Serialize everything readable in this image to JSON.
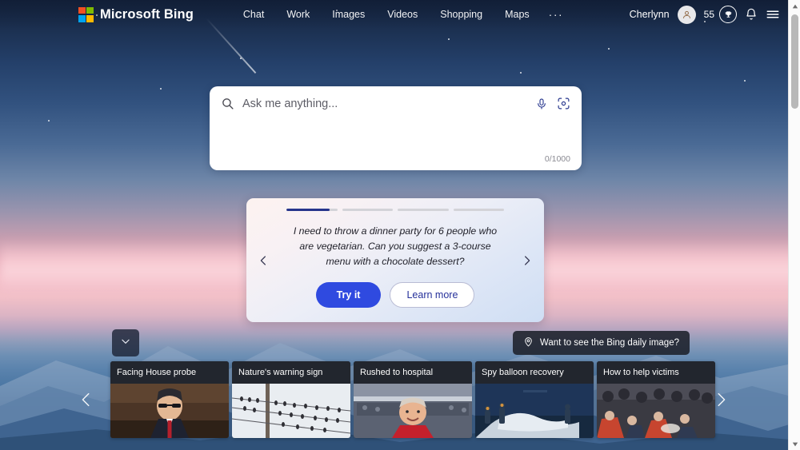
{
  "header": {
    "brand": "Microsoft Bing",
    "logo_colors": [
      "#f25022",
      "#7fba00",
      "#00a4ef",
      "#ffb900"
    ],
    "nav": [
      {
        "label": "Chat",
        "name": "nav-item-chat"
      },
      {
        "label": "Work",
        "name": "nav-item-work"
      },
      {
        "label": "Images",
        "name": "nav-item-images"
      },
      {
        "label": "Videos",
        "name": "nav-item-videos"
      },
      {
        "label": "Shopping",
        "name": "nav-item-shopping"
      },
      {
        "label": "Maps",
        "name": "nav-item-maps"
      }
    ],
    "more_label": "···",
    "user_name": "Cherlynn",
    "rewards_count": "55",
    "icons": {
      "avatar": "user-avatar-icon",
      "rewards": "trophy-icon",
      "notifications": "bell-icon",
      "menu": "hamburger-menu-icon"
    }
  },
  "search": {
    "placeholder": "Ask me anything...",
    "value": "",
    "counter": "0/1000",
    "icons": {
      "search": "search-icon",
      "mic": "microphone-icon",
      "visual": "visual-search-icon"
    }
  },
  "promo": {
    "progress": {
      "segments": 4,
      "active_index": 0,
      "active_fill_pct": 85,
      "active_color": "#26358c",
      "track_color": "#d3d3d8"
    },
    "prompt_text": "I need to throw a dinner party for 6 people who are vegetarian. Can you suggest a 3-course menu with a chocolate dessert?",
    "primary_button": "Try it",
    "secondary_button": "Learn more",
    "prev_label": "‹",
    "next_label": "›"
  },
  "bottom": {
    "collapse_icon": "chevron-down-icon",
    "daily_image_pill": {
      "label": "Want to see the Bing daily image?",
      "icon": "location-pin-icon"
    },
    "carousel_prev_icon": "chevron-left-icon",
    "carousel_next_icon": "chevron-right-icon"
  },
  "news_cards": [
    {
      "title": "Facing House probe",
      "theme": "politician-hearing"
    },
    {
      "title": "Nature's warning sign",
      "theme": "birds-on-wires"
    },
    {
      "title": "Rushed to hospital",
      "theme": "stadium-man-red"
    },
    {
      "title": "Spy balloon recovery",
      "theme": "balloon-debris-boat"
    },
    {
      "title": "How to help victims",
      "theme": "crowd-aid"
    }
  ],
  "scrollbar": {
    "up_icon": "caret-up-icon",
    "down_icon": "caret-down-icon",
    "thumb": "scrollbar-thumb"
  },
  "background": {
    "description": "sunset-sky-over-mountains",
    "sky_top": "#16243f",
    "sky_pink": "#f3bcc6",
    "mountain_blue": "#3d6694"
  }
}
